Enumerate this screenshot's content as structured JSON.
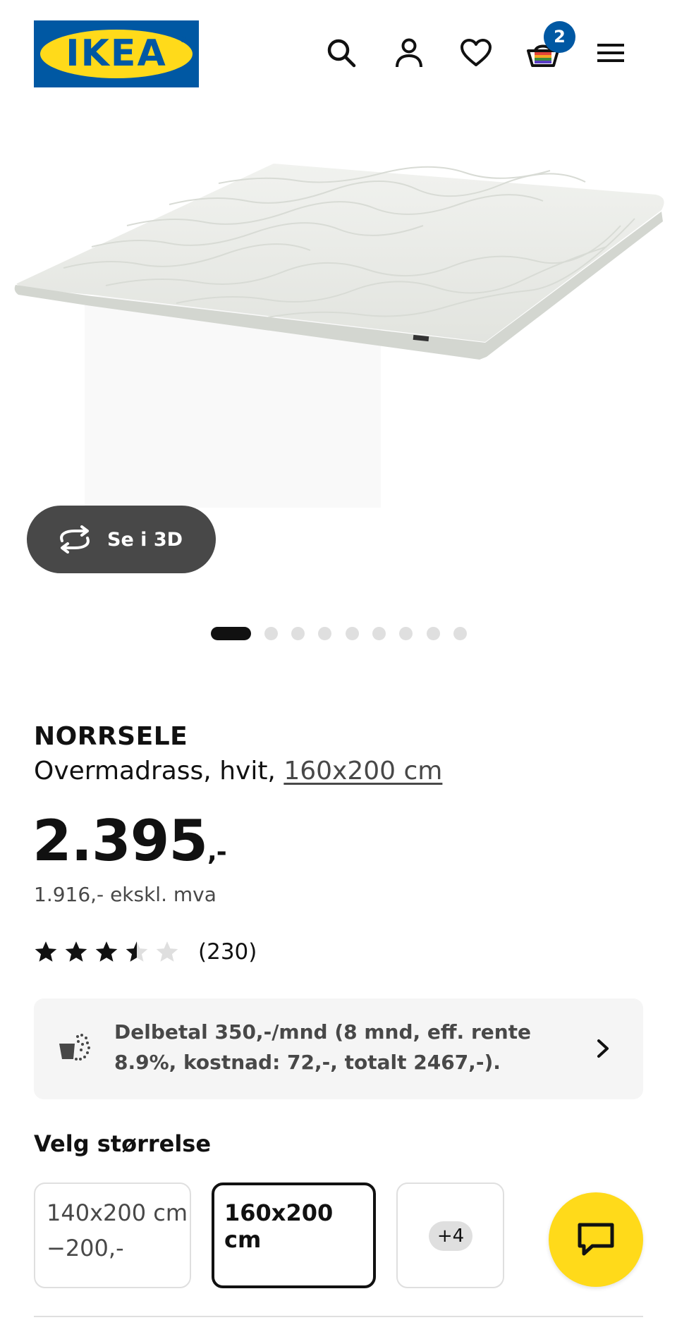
{
  "header": {
    "logo_text": "IKEA",
    "icons": [
      "search-icon",
      "profile-icon",
      "heart-icon",
      "basket-icon",
      "menu-icon"
    ],
    "cart_count": "2",
    "brand_blue": "#0058a3",
    "brand_yellow": "#ffda1a"
  },
  "gallery": {
    "view_3d_label": "Se i 3D",
    "image_count": 9,
    "active_image_index": 0
  },
  "product": {
    "name": "NORRSELE",
    "description": "Overmadrass, hvit,",
    "size_link": "160x200 cm",
    "price": "2.395",
    "price_suffix": ",-",
    "price_ex_vat": "1.916,- ekskl. mva",
    "rating_value": 3.5,
    "rating_max": 5,
    "review_count": "(230)"
  },
  "financing": {
    "text": "Delbetal 350,-/mnd (8 mnd, eff. rente 8.9%, kostnad: 72,-, totalt 2467,-)."
  },
  "size_selector": {
    "label": "Velg størrelse",
    "options": [
      {
        "size": "140x200 cm",
        "price_diff": "−200,-",
        "selected": false
      },
      {
        "size": "160x200 cm",
        "price_diff": "",
        "selected": true
      }
    ],
    "more_label": "+4"
  },
  "chat": {
    "icon": "chat-bubble-icon"
  }
}
